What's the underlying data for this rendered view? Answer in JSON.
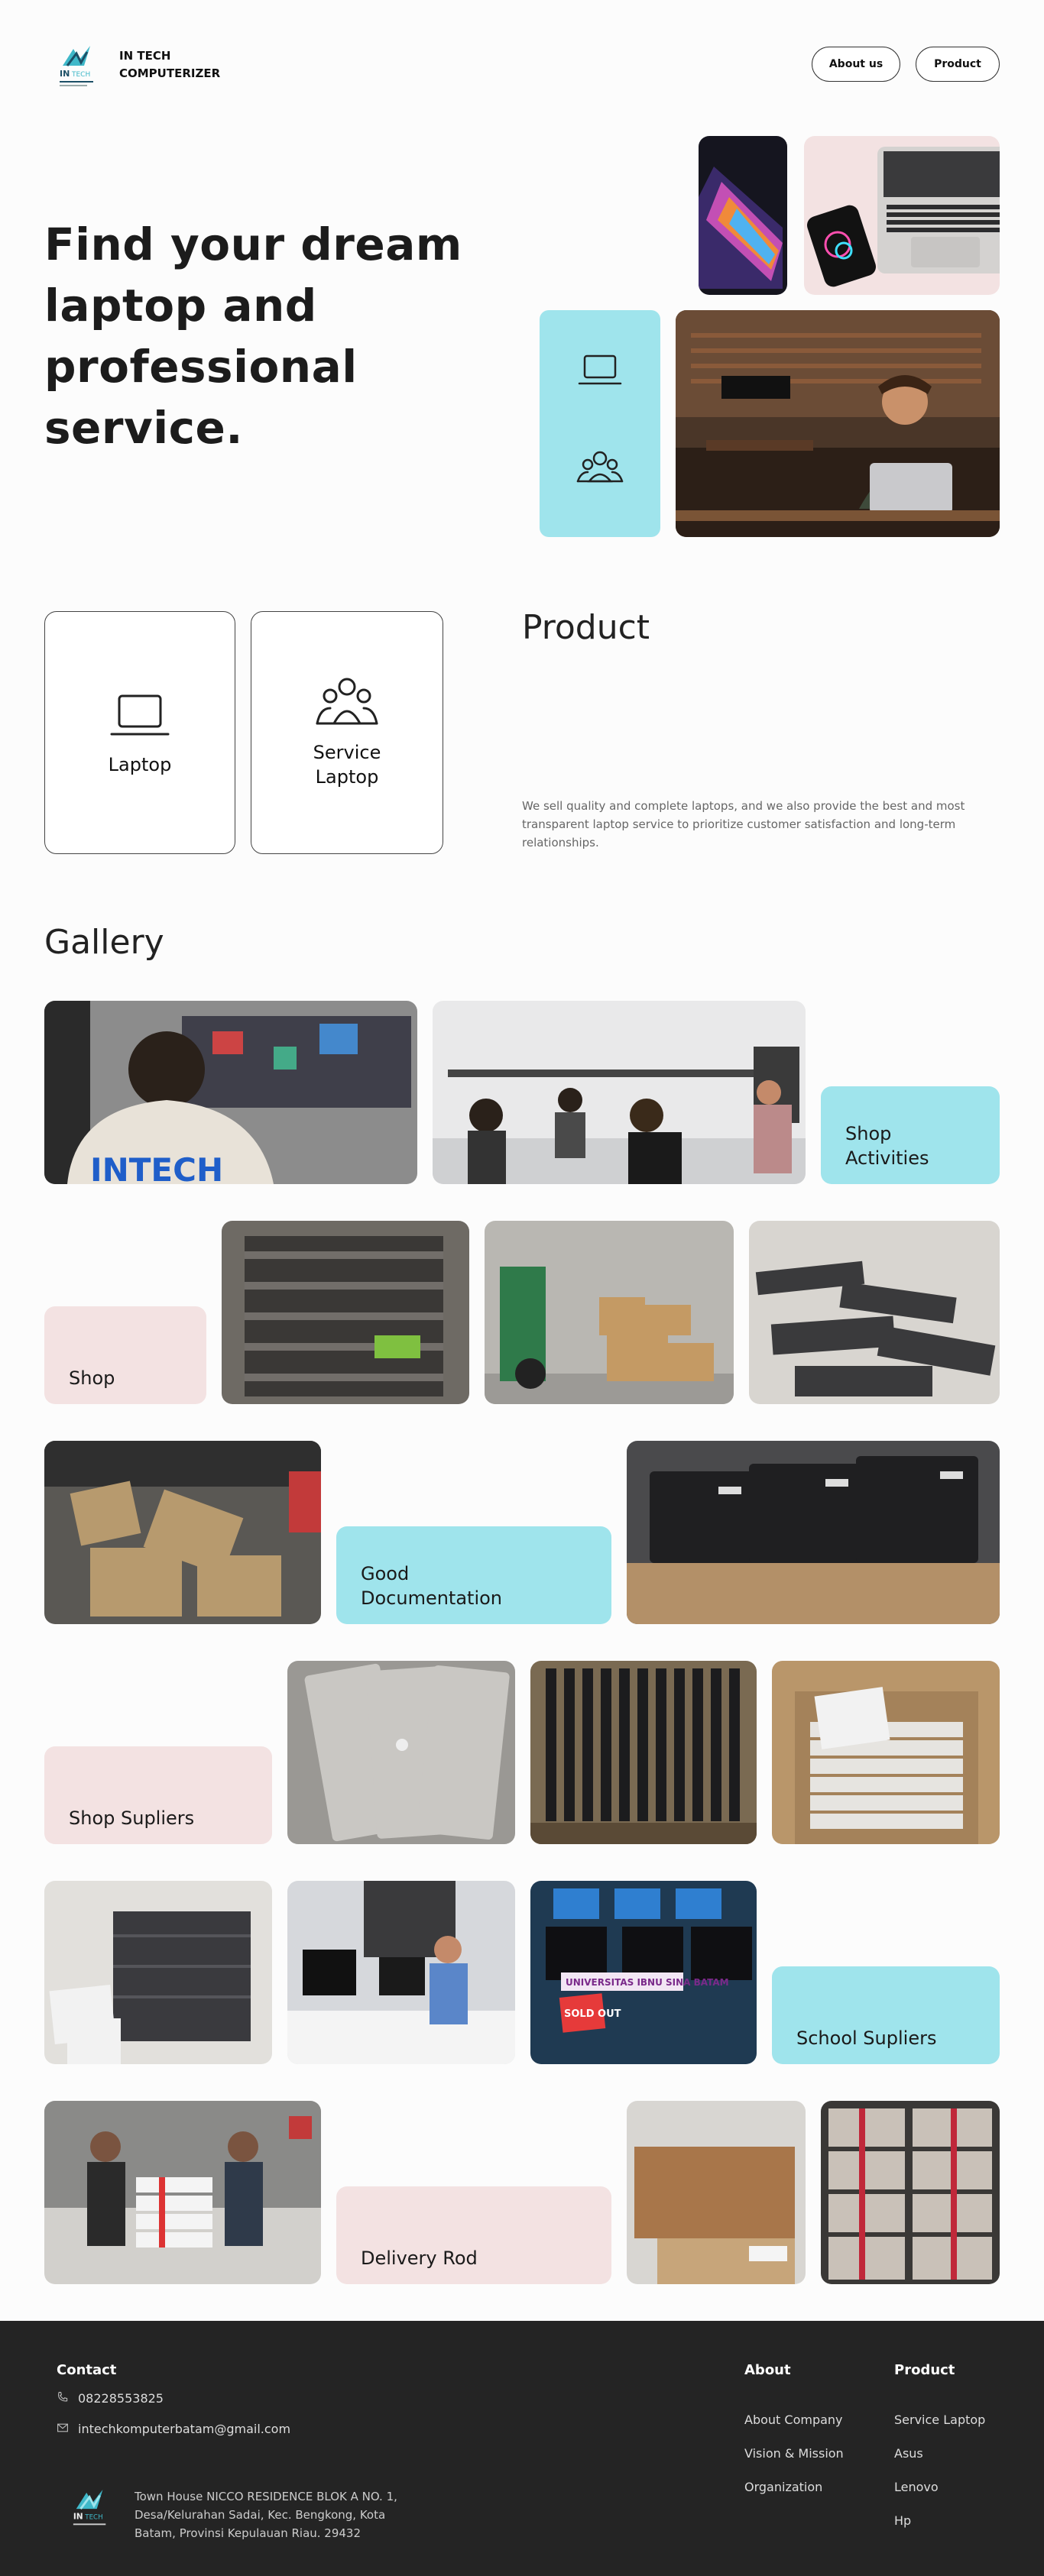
{
  "header": {
    "brand_line1": "IN TECH",
    "brand_line2": "COMPUTERIZER",
    "nav": {
      "about": "About us",
      "product": "Product"
    }
  },
  "hero": {
    "title_lines": [
      "Find your dream",
      "laptop and",
      "professional",
      "service."
    ]
  },
  "product": {
    "title": "Product",
    "cards": [
      {
        "label": "Laptop",
        "icon": "laptop-icon"
      },
      {
        "label_line1": "Service",
        "label_line2": "Laptop",
        "icon": "users-icon"
      }
    ],
    "description": "We sell quality and complete laptops, and we also provide the best and most transparent laptop service to prioritize customer satisfaction and long-term relationships."
  },
  "gallery": {
    "title": "Gallery",
    "labels": {
      "shop_activities_1": "Shop",
      "shop_activities_2": "Activities",
      "shop": "Shop",
      "good_doc_1": "Good",
      "good_doc_2": "Documentation",
      "shop_supliers": "Shop Supliers",
      "school_supliers": "School Supliers",
      "delivery": "Delivery Rod"
    },
    "sign_text": "UNIVERSITAS IBNU SINA BATAM",
    "sold_out": "SOLD OUT",
    "shirt_text": "INTECH"
  },
  "footer": {
    "contact_title": "Contact",
    "phone": "08228553825",
    "email": "intechkomputerbatam@gmail.com",
    "address_line1": "Town House NICCO RESIDENCE BLOK A NO. 1,",
    "address_line2": "Desa/Kelurahan Sadai, Kec. Bengkong, Kota",
    "address_line3": "Batam, Provinsi Kepulauan Riau. 29432",
    "about_title": "About",
    "about_links": [
      "About Company",
      "Vision & Mission",
      "Organization"
    ],
    "product_title": "Product",
    "product_links": [
      "Service Laptop",
      "Asus",
      "Lenovo",
      "Hp"
    ]
  },
  "colors": {
    "teal": "#9fe4ec",
    "pink": "#f3e2e2",
    "footer": "#242424"
  }
}
